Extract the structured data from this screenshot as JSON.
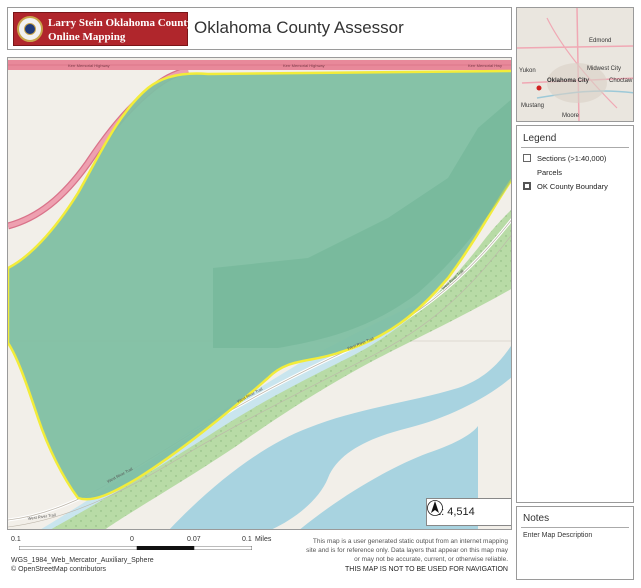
{
  "header": {
    "logo_line1": "Larry Stein Oklahoma County Assessor",
    "logo_line2": "Online Mapping",
    "title": "Oklahoma County Assessor"
  },
  "map": {
    "roads": {
      "highway_top": "Kilpatrick Turnpike / Kerr Memorial Highway",
      "highway_label_1": "Kerr Memorial Highway",
      "highway_label_2": "Kerr Memorial Highway",
      "highway_label_3": "Kerr Memorial Hwy",
      "river_trail_1": "West River Trail",
      "river_trail_2": "West River Trail",
      "river_trail_3": "West River Trail",
      "river_trail_4": "West River Trail",
      "river_trail_5": "West River Trail"
    },
    "scale_ratio": "1: 4,514",
    "colors": {
      "land": "#f2efe9",
      "parcel_fill": "#7fbfa3",
      "parcel_outline": "#f2ec3a",
      "park": "#b8dba6",
      "water": "#a8d3e0",
      "highway": "#e8899a"
    }
  },
  "footer": {
    "scale_labels": [
      "0.1",
      "0",
      "0.07",
      "0.1",
      "Miles"
    ],
    "crs": "WGS_1984_Web_Mercator_Auxiliary_Sphere",
    "attribution": "© OpenStreetMap contributors",
    "disclaimer": "This map is a user generated static output from an internet mapping site and is for reference only. Data layers that appear on this map may or may not be accurate, current, or otherwise reliable.",
    "nav_warning": "THIS MAP IS NOT TO BE USED FOR NAVIGATION"
  },
  "overview": {
    "labels": [
      "Edmond",
      "Oklahoma City",
      "Choctaw",
      "Midwest City",
      "Mustang",
      "Moore",
      "Yukon"
    ]
  },
  "legend": {
    "title": "Legend",
    "items": [
      {
        "label": "Sections (>1:40,000)"
      },
      {
        "label": "Parcels"
      },
      {
        "label": "OK County Boundary"
      }
    ]
  },
  "notes": {
    "title": "Notes",
    "description": "Enter Map Description"
  }
}
